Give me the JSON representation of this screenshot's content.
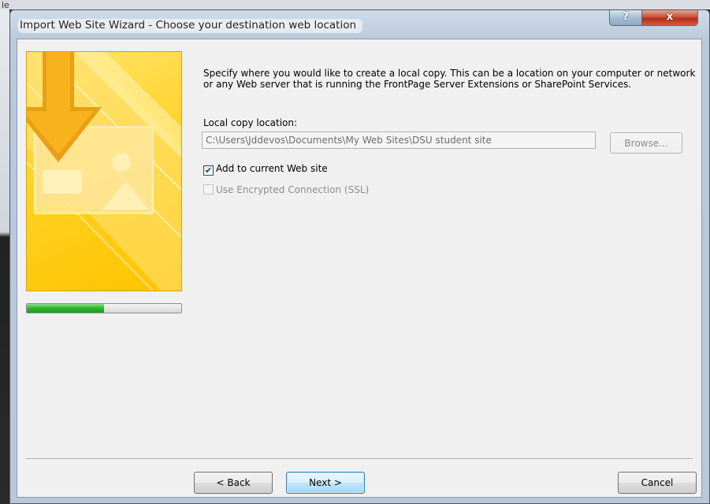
{
  "window": {
    "title": "Import Web Site Wizard - Choose your destination web location",
    "help_label": "?",
    "close_label": "x"
  },
  "background": {
    "fragment": "le"
  },
  "progress": {
    "value_fraction": 0.5,
    "color": "#2fb52b"
  },
  "content": {
    "instructions": "Specify where you would like to create a local copy.  This can be a location on your computer or network or any Web server that is running the FrontPage Server Extensions or SharePoint Services.",
    "location_label": "Local copy location:",
    "location_value": "C:\\Users\\Jddevos\\Documents\\My Web Sites\\DSU student site",
    "browse_label": "Browse...",
    "add_to_site_label": "Add to current Web site",
    "add_to_site_checked": true,
    "ssl_label": "Use Encrypted Connection (SSL)",
    "ssl_checked": false
  },
  "footer": {
    "back_label": "< Back",
    "next_label": "Next >",
    "cancel_label": "Cancel"
  },
  "colors": {
    "banner_yellow": "#ffcf1e",
    "close_red": "#c8503b",
    "default_button_blue": "#3c7fb1"
  }
}
